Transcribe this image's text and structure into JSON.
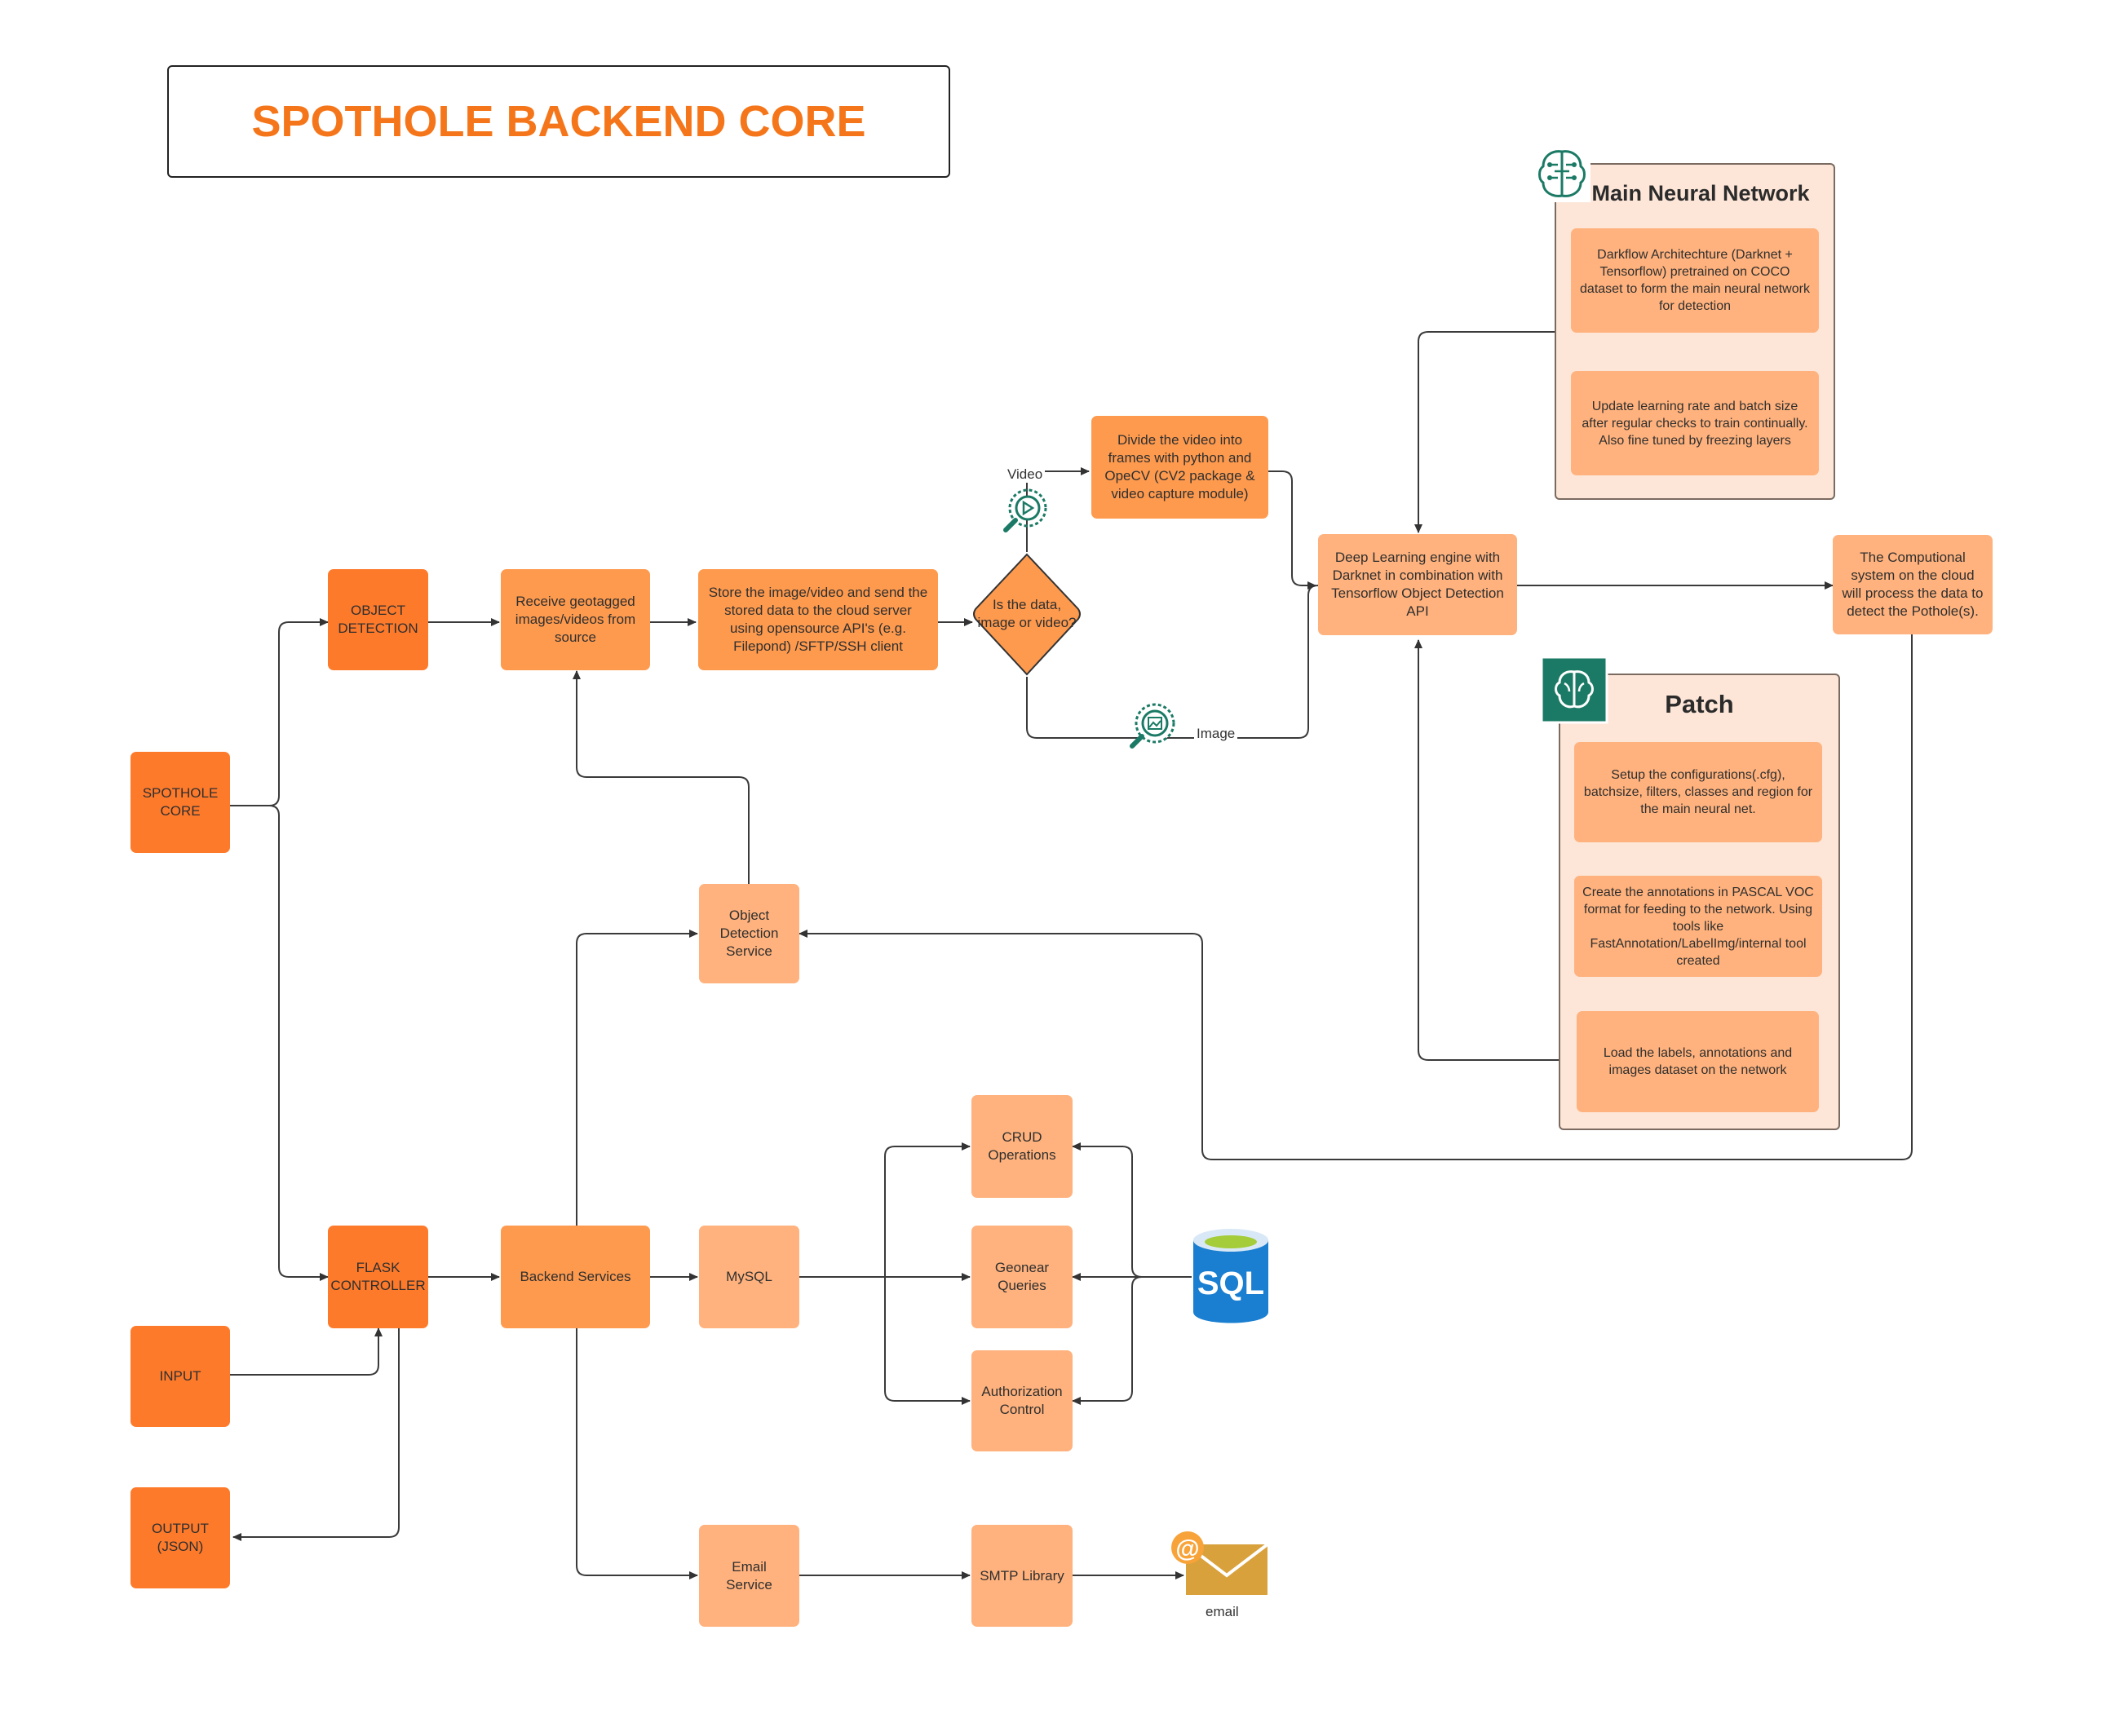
{
  "title": "SPOTHOLE BACKEND CORE",
  "colors": {
    "dark_orange": "#fe7a2b",
    "mid_orange": "#fe9a4e",
    "light_orange": "#ffb27d",
    "panel": "#fde6d8",
    "title": "#f5761a",
    "teal_icon": "#1b7a65"
  },
  "nodes": {
    "spothole_core": "SPOTHOLE CORE",
    "object_detection": "OBJECT DETECTION",
    "flask_controller": "FLASK CONTROLLER",
    "input": "INPUT",
    "output": "OUTPUT (JSON)",
    "receive": "Receive geotagged images/videos from source",
    "store": "Store the image/video and send the stored data to the cloud server using opensource API's (e.g. Filepond) /SFTP/SSH client",
    "decision": "Is the data, image or video?",
    "divide_video": "Divide the video into frames with python and OpeCV (CV2 package & video capture module)",
    "dl_engine": "Deep Learning engine with Darknet in combination with Tensorflow Object Detection API",
    "computational": "The Computional system on the cloud will process the data to detect the Pothole(s).",
    "object_detection_service": "Object Detection Service",
    "backend_services": "Backend Services",
    "mysql": "MySQL",
    "crud": "CRUD Operations",
    "geonear": "Geonear Queries",
    "authorization": "Authorization Control",
    "email_service": "Email Service",
    "smtp": "SMTP Library"
  },
  "edge_labels": {
    "video": "Video",
    "image": "Image",
    "email": "email"
  },
  "main_neural_network": {
    "title": "Main Neural Network",
    "icon": "brain-circuit-icon",
    "steps": [
      "Darkflow Architechture (Darknet + Tensorflow) pretrained on COCO dataset to form the main neural network for detection",
      "Update learning rate and batch size after regular checks to train continually. Also fine tuned by freezing layers"
    ]
  },
  "patch": {
    "title": "Patch",
    "icon": "brain-icon",
    "steps": [
      "Setup the configurations(.cfg), batchsize, filters, classes and region for the main neural net.",
      "Create the annotations in PASCAL VOC format for feeding to the network. Using tools like FastAnnotation/LabelImg/internal tool created",
      "Load the labels, annotations and images dataset on the network"
    ]
  },
  "sql_icon_text": "SQL",
  "email_icon_at": "@"
}
